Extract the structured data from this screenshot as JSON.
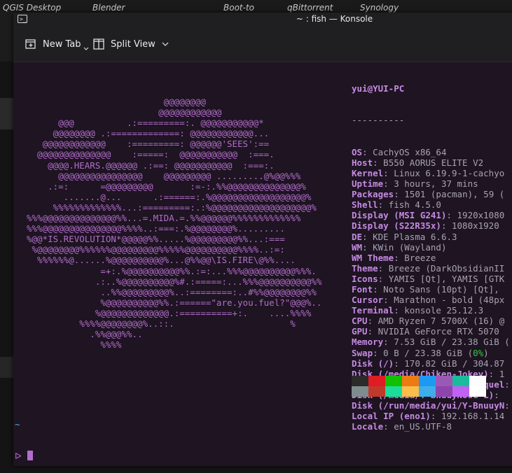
{
  "taskbar": {
    "items": [
      "QGIS Desktop",
      "Blender",
      "Boot-to",
      "qBittorrent",
      "Synology"
    ]
  },
  "window": {
    "title": "~ : fish — Konsole",
    "toolbar": {
      "new_tab_label": "New Tab",
      "split_view_label": "Split View"
    }
  },
  "terminal": {
    "user_host": "yui@YUI-PC",
    "separator": "----------",
    "logo": [
      "                          @@@@@@@@",
      "                         @@@@@@@@@@@@",
      "      @@@          .:=========:. @@@@@@@@@@@*",
      "     @@@@@@@@ .:=============: @@@@@@@@@@@@...",
      "   @@@@@@@@@@@@    :=========: @@@@@@'SEES':==",
      "  @@@@@@@@@@@@@@    :=====:  @@@@@@@@@@@  :===.",
      "    @@@@.HEARS.@@@@@@ .:==: @@@@@@@@@@@  :===:.",
      "      @@@@@@@@@@@@@@@@    @@@@@@@@@ .........@%@@%%%",
      "    .:=:      =@@@@@@@@@       :=-:.%%@@@@@@@@@@@@@@%",
      "       .......@...      .:======:.%@@@@@@@@@@@@@@@@@@%",
      "     %%%%%%%%%%%%%...:=========:.:%@@@@@@@@@@@@@@@@@@@%",
      "%%%@@@@@@@@@@@@@@%%...=.MIDA.=.%%@@@@@@%%%%%%%%%%%%%",
      "%%%@@@@@@@@@@@@@@@%%%%..:===:.%@@@@@@@@%.........",
      "%@@*IS.REVOLUTION*@@@@@%%.....%@@@@@@@@@%%...:===",
      " %@@@@@@@@%%%%%%@@@@@@@@@%%%%%@@@@@@@@@@%%%%..:=:",
      "  %%%%%%@......%@@@@@@@@@@%...@%%@@\\IS.FIRE\\@%%....",
      "              =+:.%@@@@@@@@@@%%.:=:...%%%@@@@@@@@@@%%%.",
      "             .:..%@@@@@@@@@@%#.:=====:...%%%@@@@@@@@@@%%",
      "              ..%%@@@@@@@@@%..:========:..#%%@@@@@@@@%%",
      "              %@@@@@@@@@@%%.:======\"are.you.fuel?\"@@@%..",
      "             %@@@@@@@@@@@@@.:==========+:.    ....%%%%",
      "          %%%%@@@@@@@@%..::.                      %",
      "            .%%@@@%%..",
      "              %%%%"
    ],
    "info": [
      {
        "key": "OS",
        "value": "CachyOS x86_64"
      },
      {
        "key": "Host",
        "value": "B550 AORUS ELITE V2"
      },
      {
        "key": "Kernel",
        "value": "Linux 6.19.9-1-cachyo"
      },
      {
        "key": "Uptime",
        "value": "3 hours, 37 mins"
      },
      {
        "key": "Packages",
        "value": "1501 (pacman), 59 ("
      },
      {
        "key": "Shell",
        "value": "fish 4.5.0"
      },
      {
        "key": "Display (MSI G241)",
        "value": "1920x1080"
      },
      {
        "key": "Display (S22R35x)",
        "value": "1080x1920"
      },
      {
        "key": "DE",
        "value": "KDE Plasma 6.6.3"
      },
      {
        "key": "WM",
        "value": "KWin (Wayland)"
      },
      {
        "key": "WM Theme",
        "value": "Breeze"
      },
      {
        "key": "Theme",
        "value": "Breeze (DarkObsidianII"
      },
      {
        "key": "Icons",
        "value": "YAMIS [Qt], YAMIS [GTK"
      },
      {
        "key": "Font",
        "value": "Noto Sans (10pt) [Qt],"
      },
      {
        "key": "Cursor",
        "value": "Marathon - bold (48px"
      },
      {
        "key": "Terminal",
        "value": "konsole 25.12.3"
      },
      {
        "key": "CPU",
        "value": "AMD Ryzen 7 5700X (16) @"
      },
      {
        "key": "GPU",
        "value": "NVIDIA GeForce RTX 5070"
      },
      {
        "key": "Memory",
        "value": "7.53 GiB / 23.38 GiB ("
      },
      {
        "key": "Swap",
        "value": "0 B / 23.38 GiB (",
        "highlight": "0%",
        "tail": ")"
      },
      {
        "key": "Disk (/)",
        "value": "170.82 GiB / 304.87"
      },
      {
        "key": "Disk (/media/Chiken-Jokey)",
        "value": "1"
      },
      {
        "key": "Disk (/media/Trash-The-Sequel",
        "value": ""
      },
      {
        "key": "Disk (/media/Y-BnuuyNose-L)",
        "value": ""
      },
      {
        "key": "Disk (/run/media/yui/Y-BnuuyN",
        "value": ""
      },
      {
        "key": "Local IP (eno1)",
        "value": "192.168.1.14"
      },
      {
        "key": "Locale",
        "value": "en_US.UTF-8"
      }
    ],
    "palette": {
      "row1": [
        "#2b2b2b",
        "#e01b24",
        "#12c000",
        "#ed7a12",
        "#1d99f3",
        "#9b59b6",
        "#1abc9c",
        "#fcfcfc"
      ],
      "row2": [
        "#7f8c8d",
        "#c0392b",
        "#1cdc9a",
        "#fdbc4b",
        "#3daee9",
        "#8e44ad",
        "#bf62f2",
        "#ffffff"
      ]
    },
    "prompt": {
      "cwd": "~",
      "symbol": "ᐅ"
    }
  },
  "colors": {
    "terminal_bg": "#1e1422",
    "logo": "#b36dcb",
    "key": "#c58be2",
    "value": "#a9a3b2",
    "accent_blue": "#4fb6e4"
  }
}
